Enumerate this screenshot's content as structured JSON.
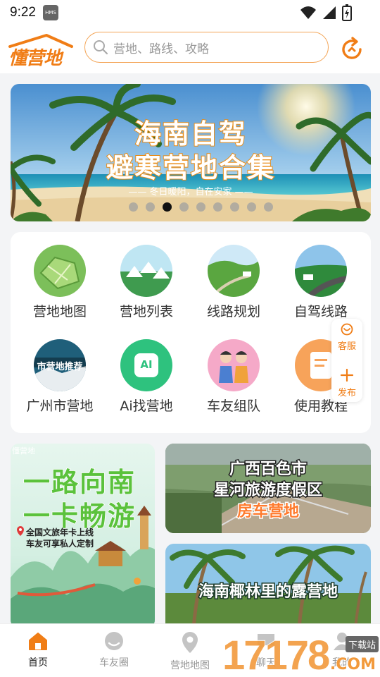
{
  "status_bar": {
    "time": "9:22",
    "hms_badge": "HMS"
  },
  "header": {
    "logo_text": "懂营地",
    "search_placeholder": "营地、路线、攻略"
  },
  "banner": {
    "title_line1": "海南自驾",
    "title_line2": "避寒营地合集",
    "subtitle": "—— 冬日暖阳，自在安家 ——",
    "page_count": 9,
    "active_index": 2
  },
  "features": [
    {
      "label": "营地地图",
      "icon": "map-thumbnail"
    },
    {
      "label": "营地列表",
      "icon": "tents-thumbnail"
    },
    {
      "label": "线路规划",
      "icon": "road-hills-thumbnail"
    },
    {
      "label": "自驾线路",
      "icon": "coast-road-thumbnail"
    },
    {
      "label": "广州市营地",
      "icon": "city-camp-thumbnail",
      "overlay": "市营地推荐"
    },
    {
      "label": "Ai找营地",
      "icon": "ai-icon",
      "overlay": "AI"
    },
    {
      "label": "车友组队",
      "icon": "friends-thumbnail"
    },
    {
      "label": "使用教程",
      "icon": "tutorial-thumbnail"
    }
  ],
  "floating": {
    "service": "客服",
    "publish": "发布"
  },
  "cards": {
    "left": {
      "watermark": "懂营地",
      "line1": "一路向南",
      "line2": "一卡畅游",
      "note1": "全国文旅年卡上线",
      "note2": "车友可享私人定制"
    },
    "right_top": {
      "line1": "广西百色市",
      "line2": "星河旅游度假区",
      "line3": "房车营地"
    },
    "right_bottom": {
      "line1": "海南椰林里的露营地"
    }
  },
  "tabs": [
    {
      "label": "首页",
      "active": true
    },
    {
      "label": "车友圈",
      "active": false
    },
    {
      "label": "营地地图",
      "active": false
    },
    {
      "label": "聊天",
      "active": false
    },
    {
      "label": "我的",
      "active": false
    }
  ],
  "watermark": {
    "number": "17178",
    "download": "下载站",
    "domain": ".COM"
  },
  "colors": {
    "accent": "#f07d16",
    "tab_active": "#f07d16",
    "tab_inactive": "#c4c4c4"
  }
}
